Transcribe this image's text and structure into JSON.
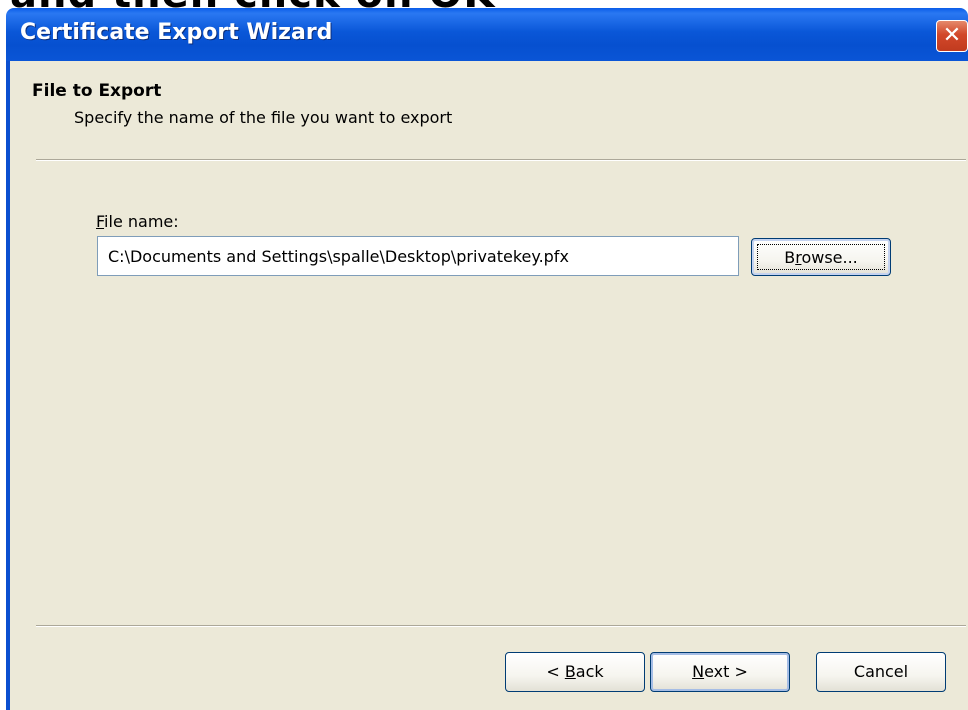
{
  "slide": {
    "caption": "and then click on OK"
  },
  "window": {
    "title": "Certificate Export Wizard",
    "close_label": "✕"
  },
  "header": {
    "title": "File to Export",
    "subtitle": "Specify the name of the file you want to export"
  },
  "form": {
    "file_label_mnemonic": "F",
    "file_label_rest": "ile name:",
    "file_value": "C:\\Documents and Settings\\spalle\\Desktop\\privatekey.pfx",
    "browse_mnemonic_pre": "B",
    "browse_mnemonic": "r",
    "browse_rest": "owse..."
  },
  "buttons": {
    "back_pre": "< ",
    "back_mnemonic": "B",
    "back_rest": "ack",
    "next_mnemonic": "N",
    "next_rest": "ext >",
    "cancel_label": "Cancel"
  },
  "colors": {
    "titlebar": "#0a57d8",
    "dialog_bg": "#ece9d8",
    "close_button": "#d2482a",
    "button_border": "#003c74"
  },
  "icons": {
    "close": "close-icon"
  }
}
